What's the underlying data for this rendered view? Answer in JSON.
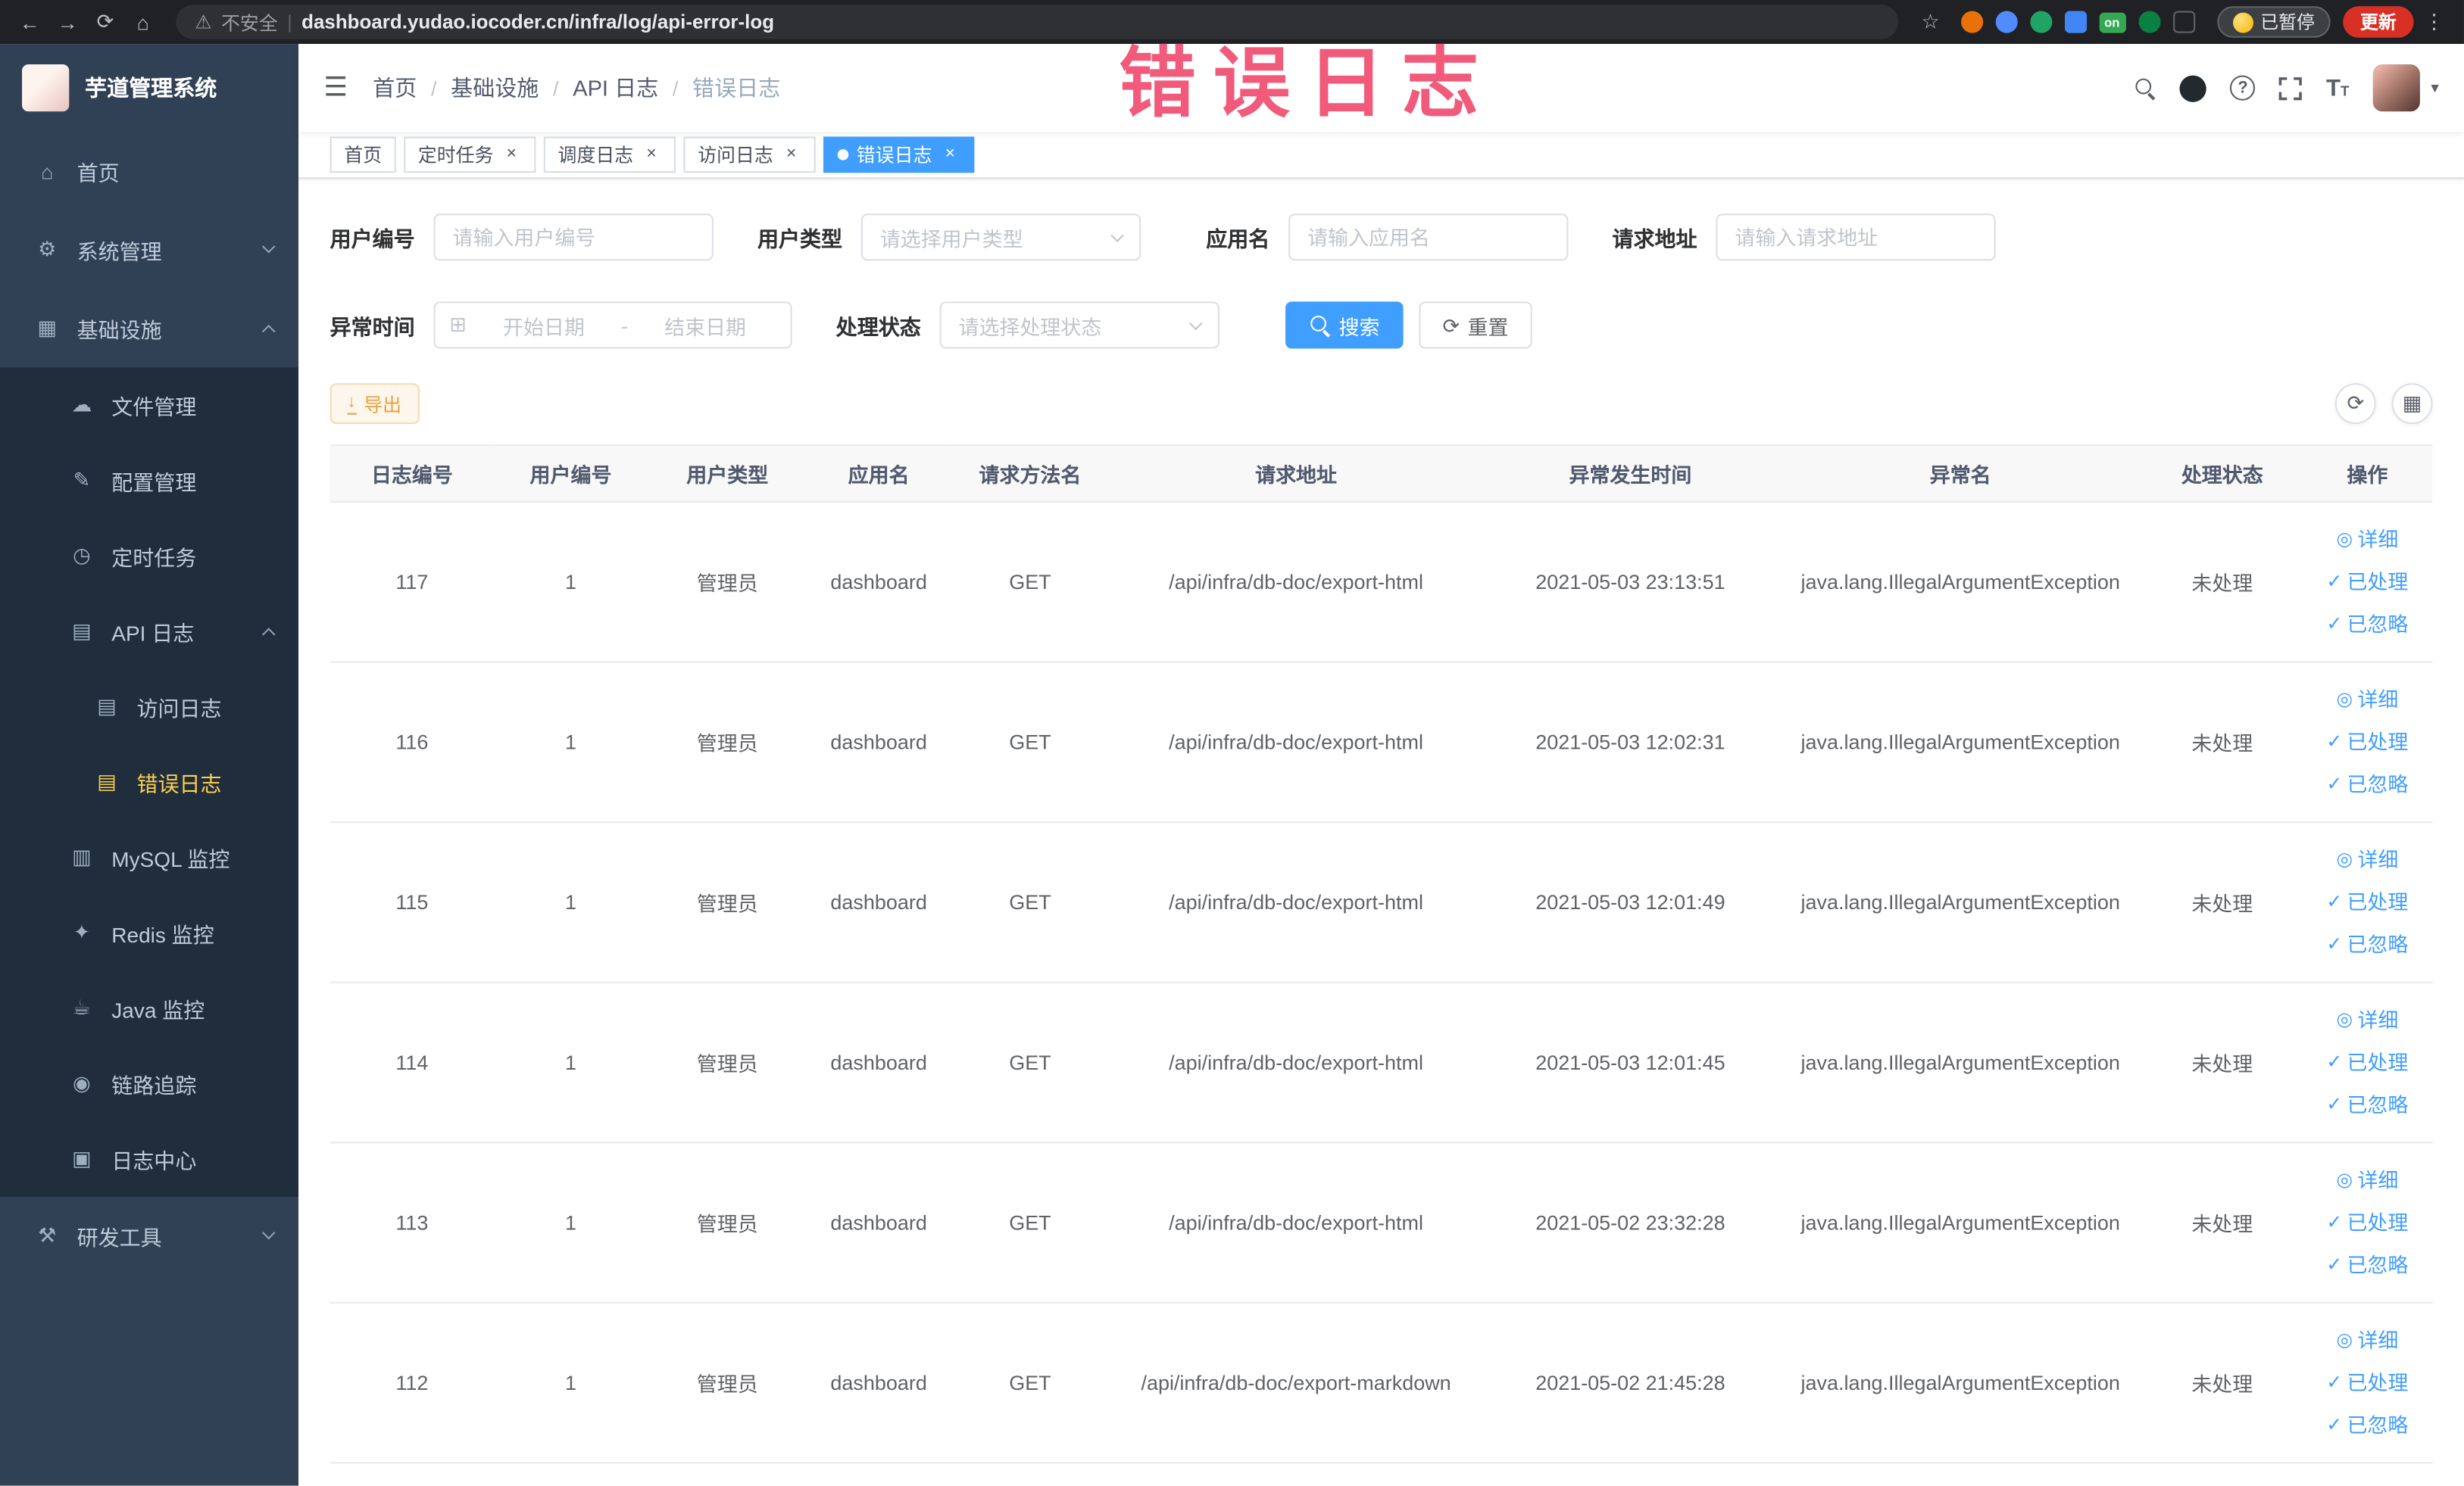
{
  "colors": {
    "accent": "#409eff",
    "sidebar_bg": "#304156",
    "sidebar_submenu_bg": "#1f2d3d",
    "sidebar_active_text": "#ffd04b",
    "export_warning": "#e6a23c",
    "watermark_pink": "#ef3f64",
    "chrome_dark": "#202124",
    "update_chip": "#d93025"
  },
  "browser": {
    "security_label": "不安全",
    "url": "dashboard.yudao.iocoder.cn/infra/log/api-error-log",
    "extension_badge": "on",
    "paused_badge": "已暂停",
    "update_button": "更新"
  },
  "annotation": {
    "watermark": "错误日志"
  },
  "icons": {
    "back": "←",
    "forward": "→",
    "reload": "⟳",
    "home": "⌂",
    "warning": "⚠",
    "divider": "|",
    "star": "☆",
    "dots": "⋮",
    "hamburger": "☰",
    "caret_down": "▾",
    "question": "?",
    "text_size": "T",
    "menu_home": "⌂",
    "menu_system": "⚙",
    "menu_infra": "▦",
    "menu_file": "☁",
    "menu_config": "✎",
    "menu_job": "◷",
    "menu_apilog": "▤",
    "menu_doc": "▤",
    "menu_mysql": "▥",
    "menu_redis": "✦",
    "menu_java": "☕",
    "menu_trace": "◉",
    "menu_logcenter": "▣",
    "menu_tools": "⚒",
    "close": "×",
    "calendar": "⊞",
    "refresh": "⟳",
    "download": "↓",
    "grid": "▦",
    "eye": "◎",
    "check": "✓"
  },
  "sidebar": {
    "logo_title": "芋道管理系统",
    "items": [
      {
        "label": "首页"
      },
      {
        "label": "系统管理"
      },
      {
        "label": "基础设施"
      },
      {
        "label": "文件管理"
      },
      {
        "label": "配置管理"
      },
      {
        "label": "定时任务"
      },
      {
        "label": "API 日志"
      },
      {
        "label": "访问日志"
      },
      {
        "label": "错误日志"
      },
      {
        "label": "MySQL 监控"
      },
      {
        "label": "Redis 监控"
      },
      {
        "label": "Java 监控"
      },
      {
        "label": "链路追踪"
      },
      {
        "label": "日志中心"
      },
      {
        "label": "研发工具"
      }
    ]
  },
  "breadcrumb": {
    "separator": "/",
    "items": [
      "首页",
      "基础设施",
      "API 日志",
      "错误日志"
    ]
  },
  "tabs": [
    {
      "label": "首页"
    },
    {
      "label": "定时任务"
    },
    {
      "label": "调度日志"
    },
    {
      "label": "访问日志"
    },
    {
      "label": "错误日志"
    }
  ],
  "filters": {
    "user_id_label": "用户编号",
    "user_id_placeholder": "请输入用户编号",
    "user_type_label": "用户类型",
    "user_type_placeholder": "请选择用户类型",
    "app_name_label": "应用名",
    "app_name_placeholder": "请输入应用名",
    "request_url_label": "请求地址",
    "request_url_placeholder": "请输入请求地址",
    "time_label": "异常时间",
    "time_start_placeholder": "开始日期",
    "time_separator": "-",
    "time_end_placeholder": "结束日期",
    "status_label": "处理状态",
    "status_placeholder": "请选择处理状态",
    "search_button": "搜索",
    "reset_button": "重置"
  },
  "toolbar": {
    "export_button": "导出"
  },
  "table": {
    "headers": [
      "日志编号",
      "用户编号",
      "用户类型",
      "应用名",
      "请求方法名",
      "请求地址",
      "异常发生时间",
      "异常名",
      "处理状态",
      "操作"
    ],
    "actions": {
      "detail": "详细",
      "processed": "已处理",
      "ignored": "已忽略"
    },
    "rows": [
      {
        "id": "117",
        "user_id": "1",
        "user_type": "管理员",
        "app_name": "dashboard",
        "method": "GET",
        "url": "/api/infra/db-doc/export-html",
        "time": "2021-05-03 23:13:51",
        "exception": "java.lang.IllegalArgumentException",
        "status": "未处理"
      },
      {
        "id": "116",
        "user_id": "1",
        "user_type": "管理员",
        "app_name": "dashboard",
        "method": "GET",
        "url": "/api/infra/db-doc/export-html",
        "time": "2021-05-03 12:02:31",
        "exception": "java.lang.IllegalArgumentException",
        "status": "未处理"
      },
      {
        "id": "115",
        "user_id": "1",
        "user_type": "管理员",
        "app_name": "dashboard",
        "method": "GET",
        "url": "/api/infra/db-doc/export-html",
        "time": "2021-05-03 12:01:49",
        "exception": "java.lang.IllegalArgumentException",
        "status": "未处理"
      },
      {
        "id": "114",
        "user_id": "1",
        "user_type": "管理员",
        "app_name": "dashboard",
        "method": "GET",
        "url": "/api/infra/db-doc/export-html",
        "time": "2021-05-03 12:01:45",
        "exception": "java.lang.IllegalArgumentException",
        "status": "未处理"
      },
      {
        "id": "113",
        "user_id": "1",
        "user_type": "管理员",
        "app_name": "dashboard",
        "method": "GET",
        "url": "/api/infra/db-doc/export-html",
        "time": "2021-05-02 23:32:28",
        "exception": "java.lang.IllegalArgumentException",
        "status": "未处理"
      },
      {
        "id": "112",
        "user_id": "1",
        "user_type": "管理员",
        "app_name": "dashboard",
        "method": "GET",
        "url": "/api/infra/db-doc/export-markdown",
        "time": "2021-05-02 21:45:28",
        "exception": "java.lang.IllegalArgumentException",
        "status": "未处理"
      }
    ]
  }
}
